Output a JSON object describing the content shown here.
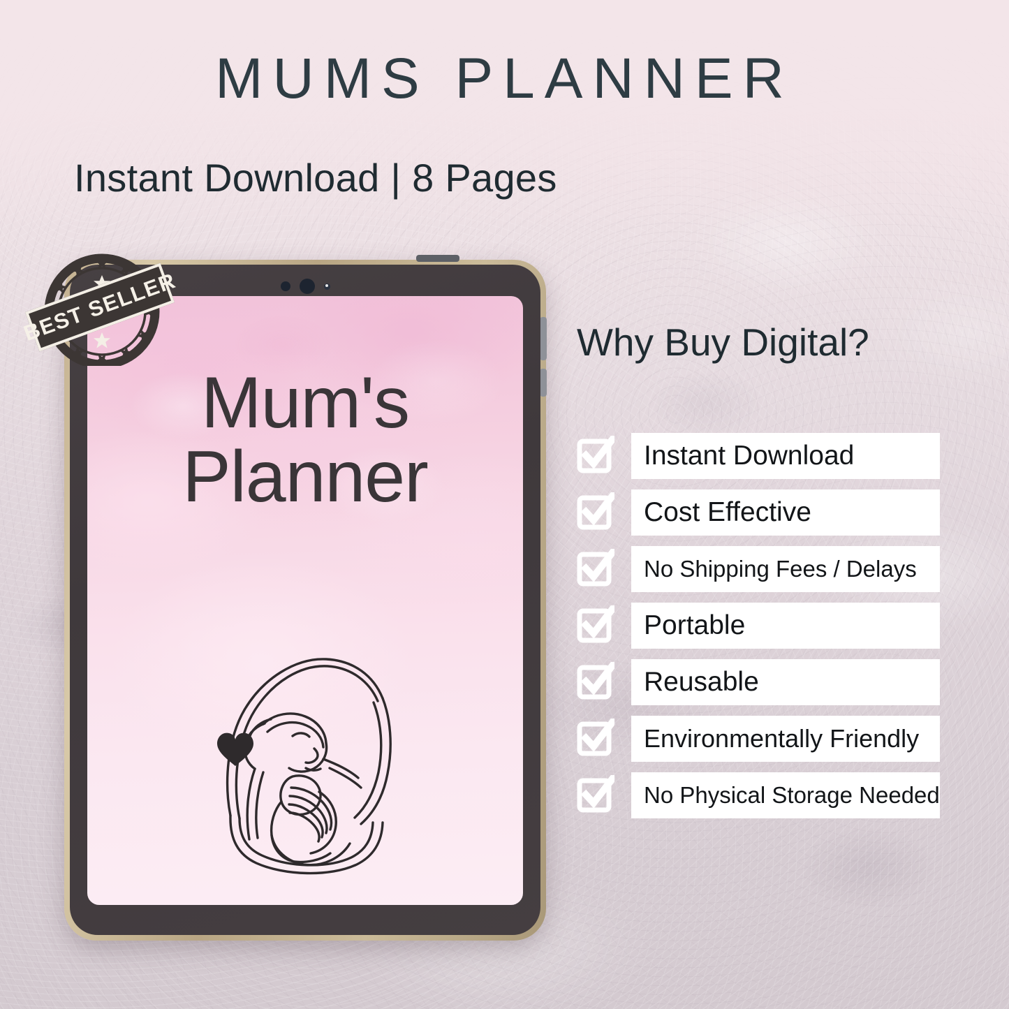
{
  "header": {
    "title": "MUMS PLANNER",
    "subtitle": "Instant Download | 8 Pages"
  },
  "badge": {
    "label": "BEST SELLER",
    "icon": "best-seller-stamp-icon"
  },
  "tablet": {
    "cover": {
      "title_line1": "Mum's",
      "title_line2": "Planner",
      "illustration": "mother-and-baby-line-art"
    },
    "hardware": {
      "power_button": "power-button",
      "volume_up": "volume-up-button",
      "volume_down": "volume-down-button",
      "camera": "front-camera"
    }
  },
  "benefits": {
    "heading": "Why Buy Digital?",
    "items": [
      {
        "label": "Instant Download",
        "size": "sz-lg"
      },
      {
        "label": "Cost Effective",
        "size": "sz-lg"
      },
      {
        "label": "No Shipping Fees / Delays",
        "size": "sz-sm"
      },
      {
        "label": "Portable",
        "size": "sz-lg"
      },
      {
        "label": "Reusable",
        "size": "sz-lg"
      },
      {
        "label": "Environmentally Friendly",
        "size": "sz-md"
      },
      {
        "label": "No Physical Storage Needed",
        "size": "sz-sm"
      }
    ],
    "checkbox_icon": "checked-checkbox-icon"
  },
  "colors": {
    "background_top": "#f2e3e7",
    "background_bottom": "#d4cad0",
    "heading_text": "#1f2b31",
    "title_text": "#2e3c43",
    "tablet_frame": "#c4b191",
    "tablet_bezel": "#433c3f",
    "screen_pink_top": "#f2c2da",
    "screen_pink_bottom": "#fcedf4",
    "label_bar": "#ffffff",
    "stamp_dark": "#3c3634",
    "stamp_cream": "#f4efe6"
  }
}
